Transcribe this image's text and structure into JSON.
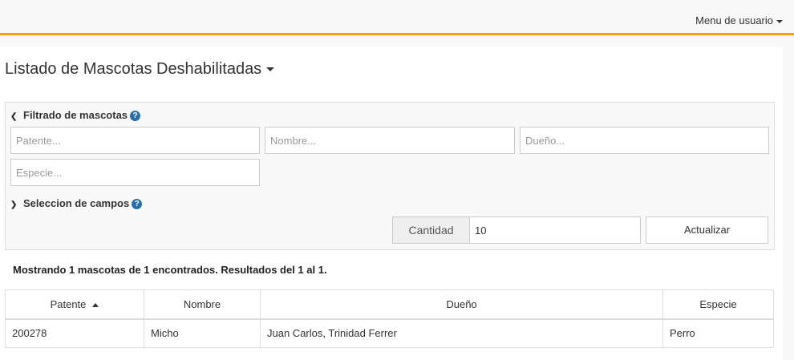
{
  "topbar": {
    "user_menu_label": "Menu de usuario"
  },
  "page": {
    "title": "Listado de Mascotas Deshabilitadas"
  },
  "filter": {
    "section_label": "Filtrado de mascotas",
    "help_glyph": "?",
    "placeholders": {
      "patente": "Patente...",
      "nombre": "Nombre...",
      "dueno": "Dueño...",
      "especie": "Especie..."
    }
  },
  "fields": {
    "section_label": "Seleccion de campos",
    "help_glyph": "?"
  },
  "pagination": {
    "cantidad_label": "Cantidad",
    "cantidad_value": "10",
    "update_label": "Actualizar"
  },
  "results": {
    "summary": "Mostrando 1 mascotas de 1 encontrados. Resultados del 1 al 1."
  },
  "table": {
    "columns": [
      "Patente",
      "Nombre",
      "Dueño",
      "Especie"
    ],
    "rows": [
      [
        "200278",
        "Micho",
        "Juan Carlos, Trinidad Ferrer",
        "Perro"
      ]
    ]
  },
  "colors": {
    "accent": "#f5a300",
    "help_icon": "#2b6fa8"
  }
}
